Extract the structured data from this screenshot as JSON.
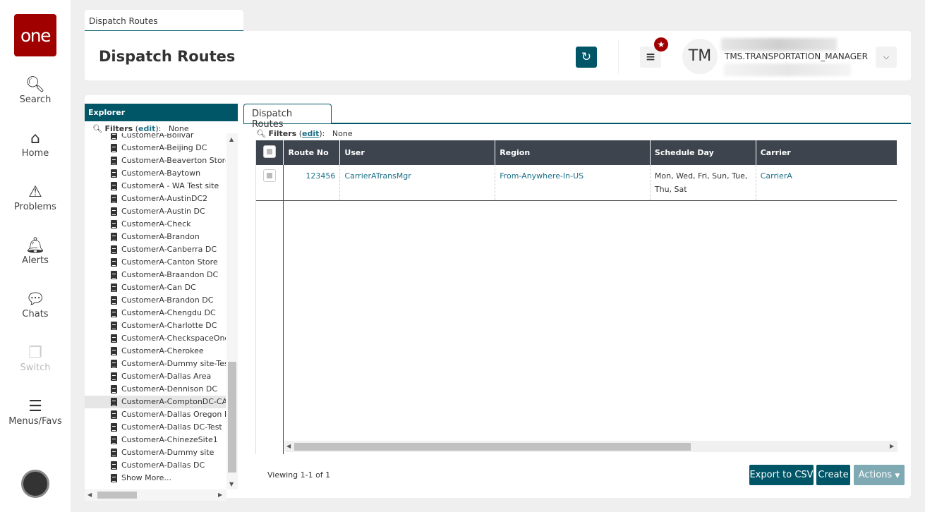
{
  "nav": {
    "logo": "one",
    "items": [
      {
        "label": "Search",
        "icon": "search-icon"
      },
      {
        "label": "Home",
        "icon": "home-icon"
      },
      {
        "label": "Problems",
        "icon": "warning-icon"
      },
      {
        "label": "Alerts",
        "icon": "bell-icon"
      },
      {
        "label": "Chats",
        "icon": "chat-icon"
      },
      {
        "label": "Switch",
        "icon": "switch-icon"
      },
      {
        "label": "Menus/Favs",
        "icon": "menu-icon"
      }
    ]
  },
  "page_tab": "Dispatch Routes",
  "header": {
    "title": "Dispatch Routes",
    "initials": "TM",
    "user": "TMS.TRANSPORTATION_MANAGER"
  },
  "explorer": {
    "title": "Explorer",
    "filters_label": "Filters",
    "edit": "edit",
    "filters_value": "None",
    "items": [
      "CustomerA-Bolivar",
      "CustomerA-Beijing DC",
      "CustomerA-Beaverton Store",
      "CustomerA-Baytown",
      "CustomerA - WA Test site",
      "CustomerA-AustinDC2",
      "CustomerA-Austin DC",
      "CustomerA-Check",
      "CustomerA-Brandon",
      "CustomerA-Canberra DC",
      "CustomerA-Canton Store",
      "CustomerA-Braandon DC",
      "CustomerA-Can DC",
      "CustomerA-Brandon DC",
      "CustomerA-Chengdu DC",
      "CustomerA-Charlotte DC",
      "CustomerA-CheckspaceOne",
      "CustomerA-Cherokee",
      "CustomerA-Dummy site-Test",
      "CustomerA-Dallas Area",
      "CustomerA-Dennison DC",
      "CustomerA-ComptonDC-CA",
      "CustomerA-Dallas Oregon DC",
      "CustomerA-Dallas DC-Test",
      "CustomerA-ChinezeSite1",
      "CustomerA-Dummy site",
      "CustomerA-Dallas DC",
      "Show More..."
    ],
    "selected": "CustomerA-ComptonDC-CA"
  },
  "main": {
    "tab": "Dispatch Routes",
    "filters_label": "Filters",
    "edit": "edit",
    "filters_value": "None",
    "columns": [
      "Route No",
      "User",
      "Region",
      "Schedule Day",
      "Carrier"
    ],
    "rows": [
      {
        "route_no": "123456",
        "user": "CarrierATransMgr",
        "region": "From-Anywhere-In-US",
        "schedule_day": "Mon, Wed, Fri, Sun, Tue, Thu, Sat",
        "carrier": "CarrierA"
      }
    ],
    "viewing": "Viewing 1-1 of 1",
    "export": "Export to CSV",
    "create": "Create",
    "actions": "Actions"
  }
}
